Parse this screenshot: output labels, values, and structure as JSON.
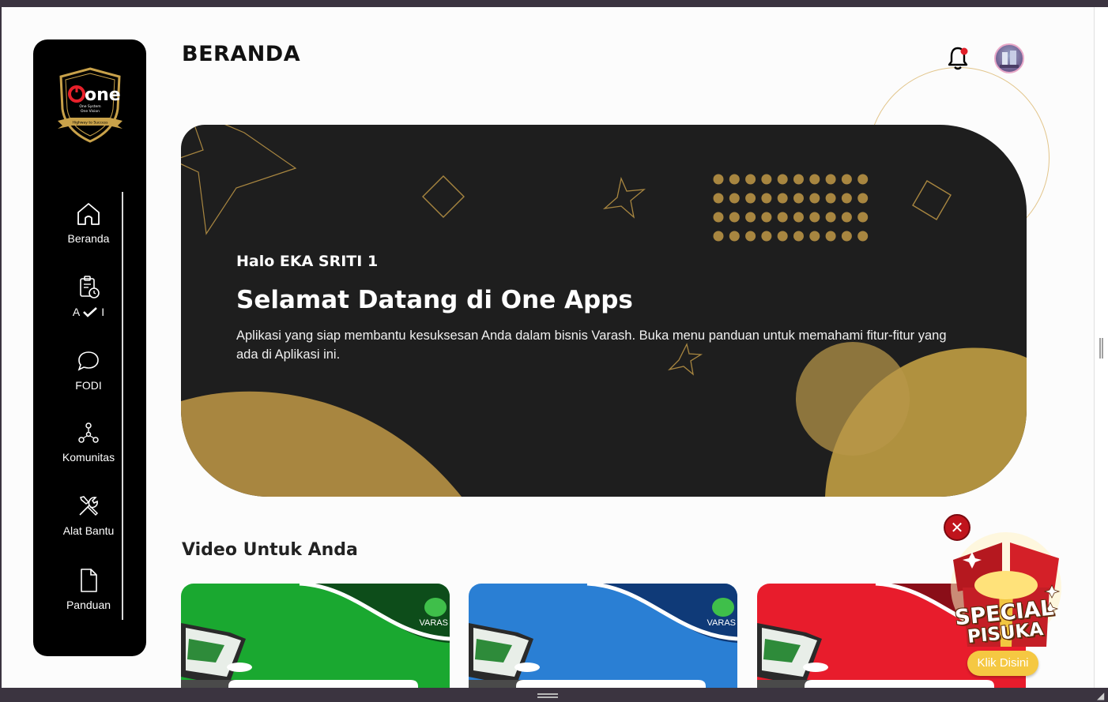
{
  "app": {
    "title": "BERANDA",
    "logo_text": "one",
    "logo_sub1": "One System",
    "logo_sub2": "One Vision",
    "logo_ribbon": "Highway to Success"
  },
  "sidebar": {
    "items": [
      {
        "label": "Beranda",
        "icon": "home-icon"
      },
      {
        "label": "A",
        "label2": "I",
        "icon": "clipboard-clock-icon"
      },
      {
        "label": "FODI",
        "icon": "chat-bubble-icon"
      },
      {
        "label": "Komunitas",
        "icon": "network-icon"
      },
      {
        "label": "Alat Bantu",
        "icon": "tools-icon"
      },
      {
        "label": "Panduan",
        "icon": "document-icon"
      }
    ]
  },
  "header": {
    "notification_icon": "bell-icon",
    "notification_dot_color": "#e0202a"
  },
  "banner": {
    "greeting": "Halo EKA SRITI 1",
    "headline": "Selamat Datang di One Apps",
    "description": "Aplikasi yang siap membantu kesuksesan Anda dalam bisnis Varash. Buka menu panduan untuk memahami fitur-fitur yang ada di Aplikasi ini.",
    "bg_color": "#1e1e1e",
    "accent_color": "#a88640"
  },
  "videos": {
    "section_title": "Video Untuk Anda",
    "cards": [
      {
        "color": "#1aa830",
        "brand": "VARAS"
      },
      {
        "color": "#2a7fd4",
        "brand": "VARAS"
      },
      {
        "color": "#e81c2c",
        "brand": ""
      }
    ]
  },
  "promo": {
    "line1": "SPECIAL",
    "line2": "PISUKA",
    "button": "Klik Disini",
    "close": "✕"
  }
}
